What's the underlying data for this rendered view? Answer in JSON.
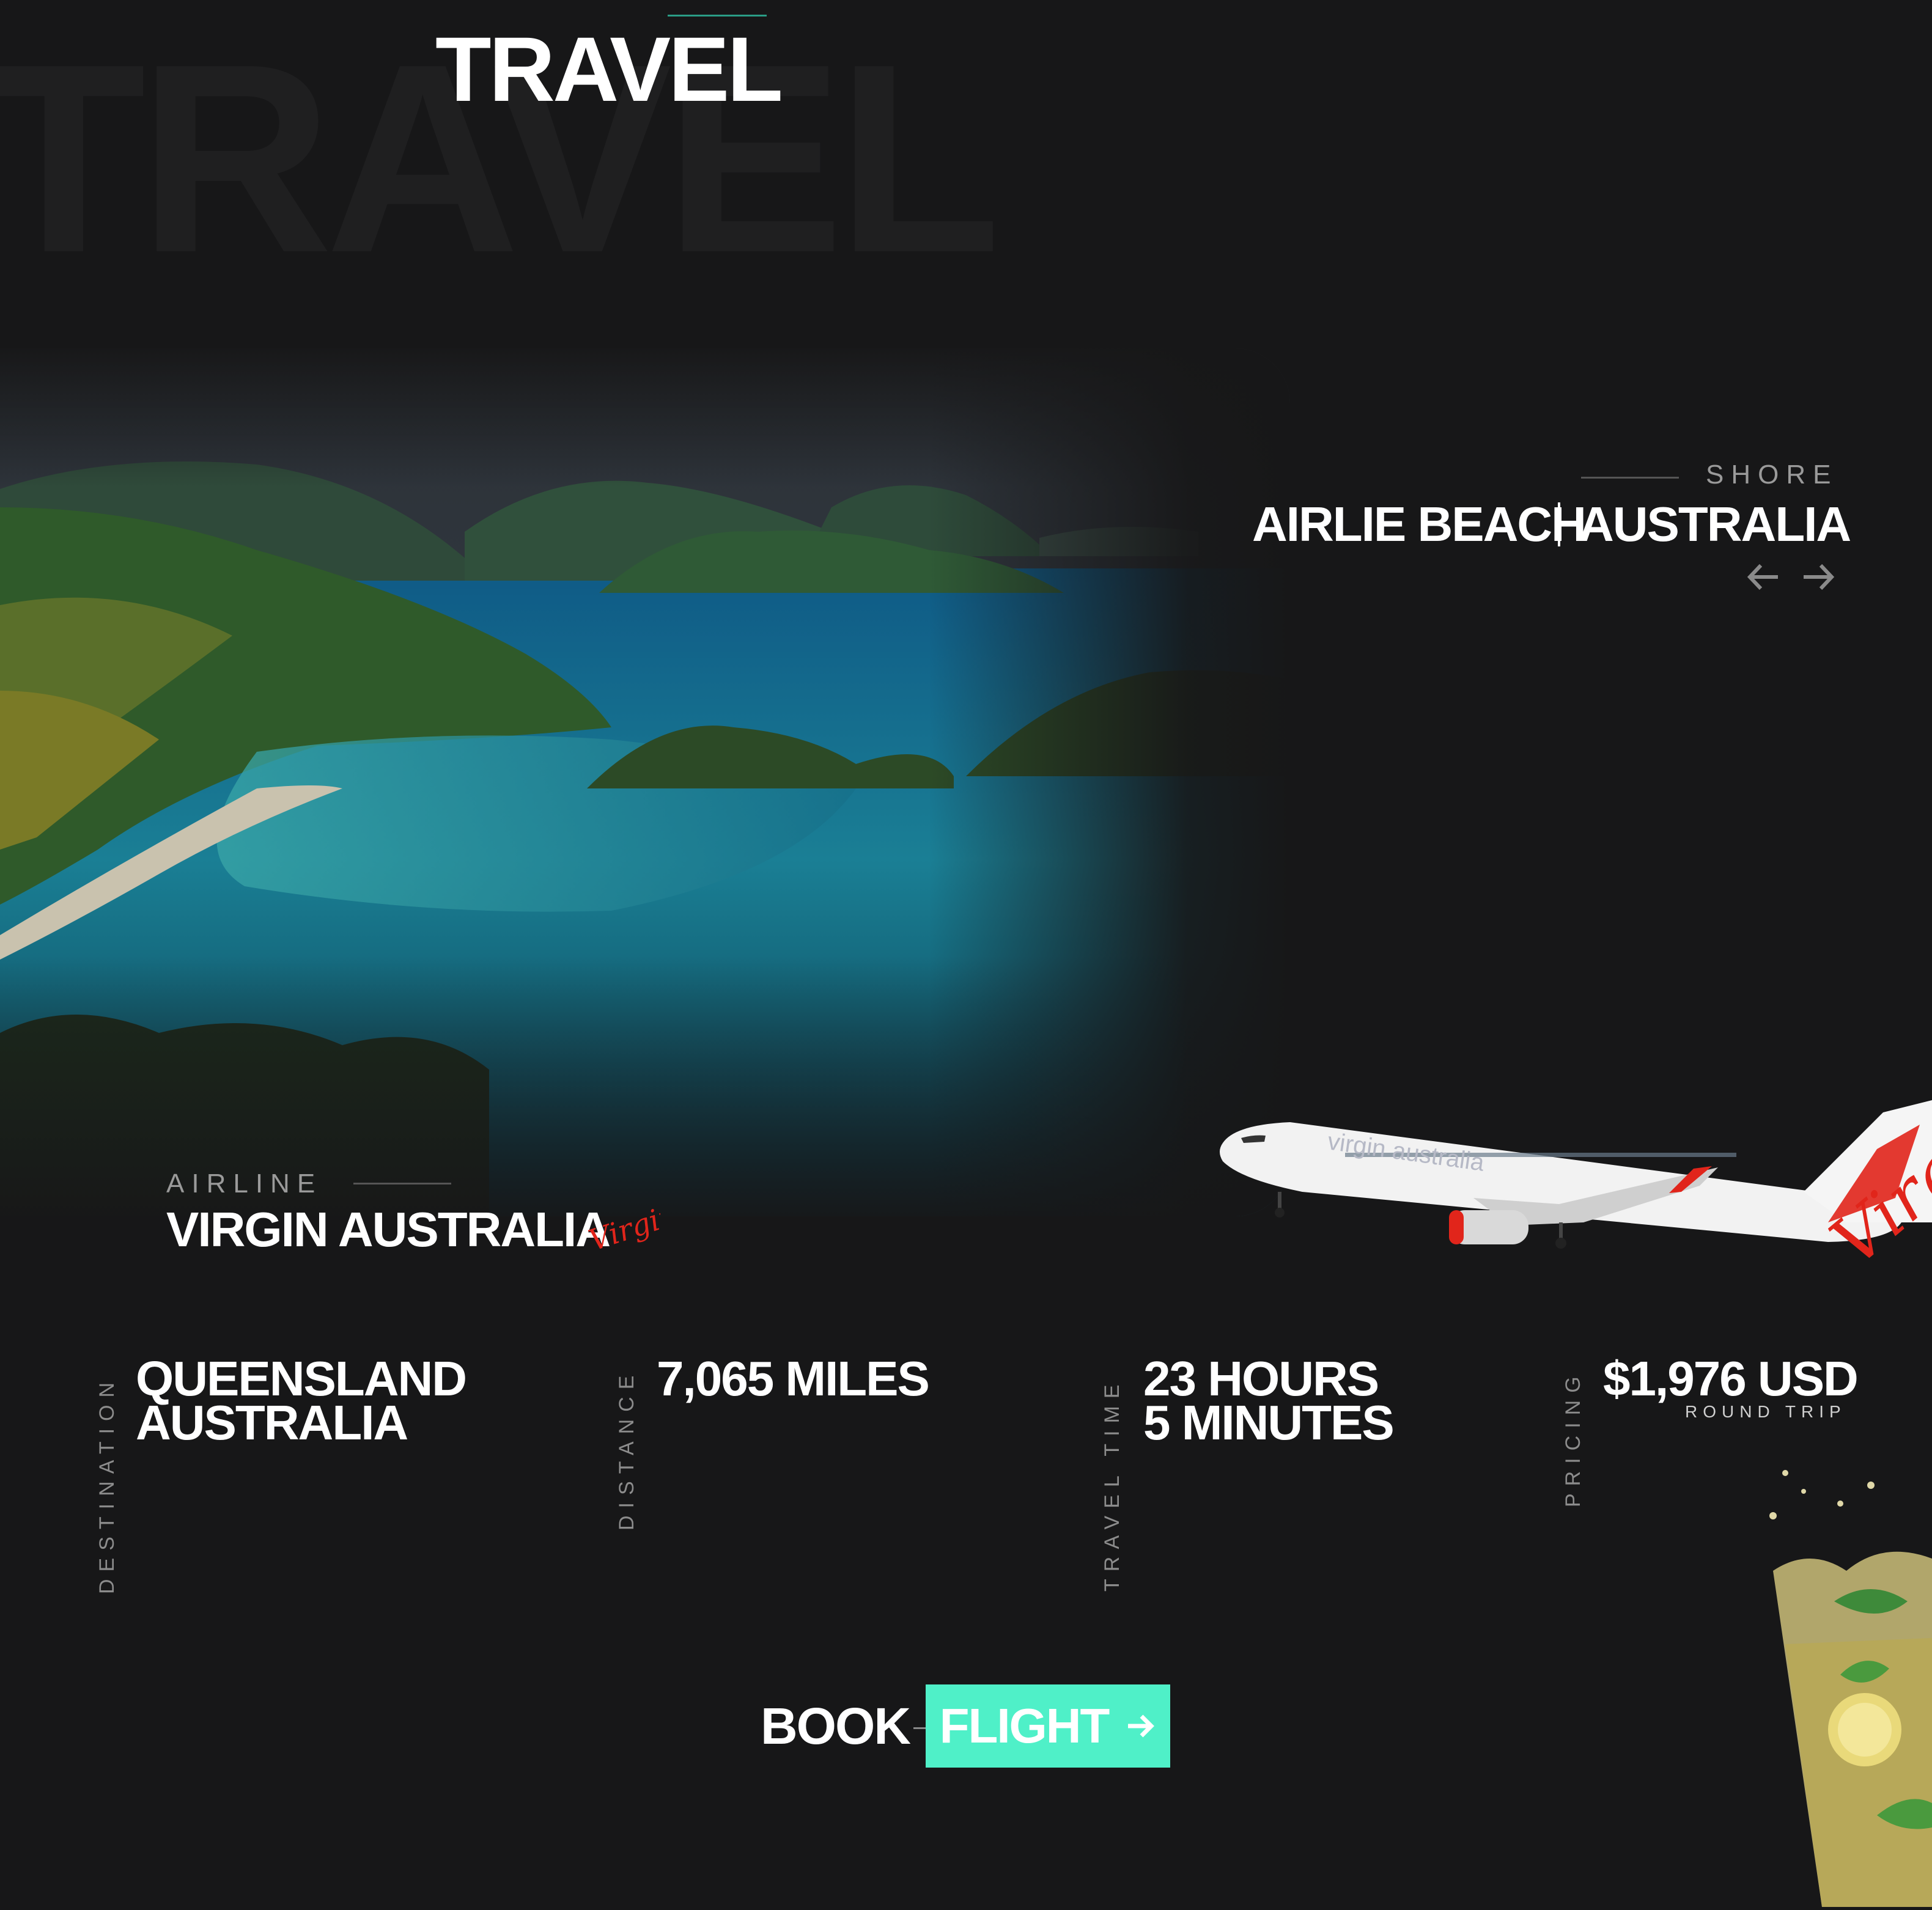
{
  "header": {
    "ghost_title": "TRAVEL",
    "title": "TRAVEL"
  },
  "location": {
    "label": "SHORE",
    "city": "AIRLIE BEACH",
    "country": "AUSTRALIA",
    "prev_icon": "arrow-left-icon",
    "next_icon": "arrow-right-icon"
  },
  "airline": {
    "label": "AIRLINE",
    "name": "VIRGIN AUSTRALIA",
    "logo_text": "Virgin",
    "plane_livery": "virgin australia",
    "brand_color": "#e1251b"
  },
  "stats": [
    {
      "label": "DESTINATION",
      "line1": "QUEENSLAND",
      "line2": "AUSTRALIA"
    },
    {
      "label": "DISTANCE",
      "line1": "7,065 MILES",
      "line2": ""
    },
    {
      "label": "TRAVEL TIME",
      "line1": "23 HOURS",
      "line2": "5 MINUTES"
    },
    {
      "label": "PRICING",
      "line1": "$1,976 USD",
      "line2": "ROUND TRIP"
    }
  ],
  "cta": {
    "book": "BOOK",
    "flight": "FLIGHT",
    "icon": "arrow-right-icon",
    "accent": "#4ff0c8"
  },
  "colors": {
    "background": "#171718",
    "accent_line": "#2a9d86"
  }
}
